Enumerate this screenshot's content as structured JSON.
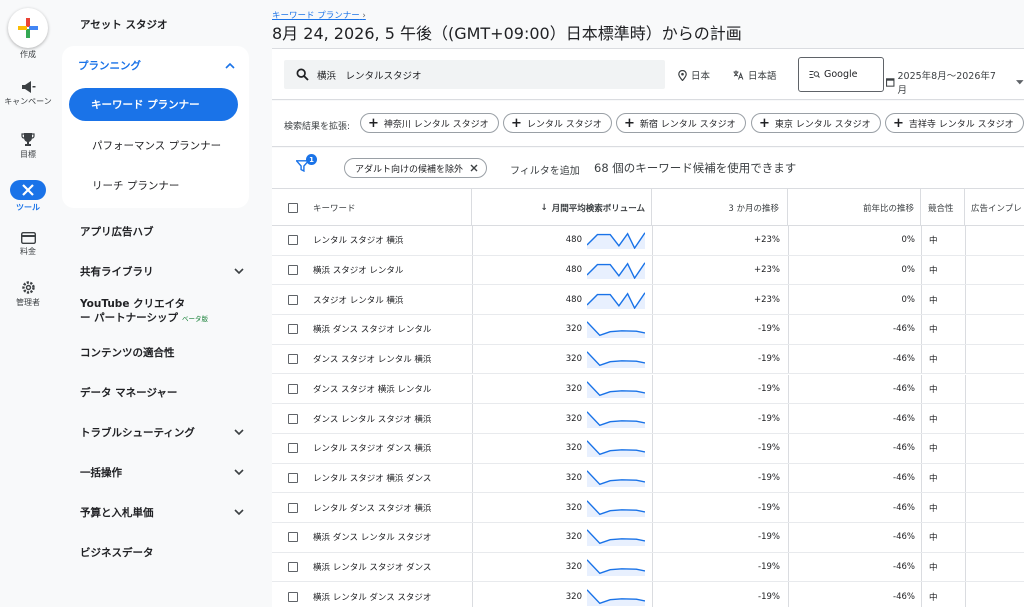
{
  "rail": {
    "create": "作成",
    "campaigns": "キャンペーン",
    "goals": "目標",
    "tools": "ツール",
    "billing": "料金",
    "admin": "管理者"
  },
  "nav": {
    "asset_studio": "アセット スタジオ",
    "planning": "プランニング",
    "keyword_planner": "キーワード プランナー",
    "performance_planner": "パフォーマンス プランナー",
    "reach_planner": "リーチ プランナー",
    "app_ad_hub": "アプリ広告ハブ",
    "shared_library": "共有ライブラリ",
    "youtube_partnership_line1": "YouTube クリエイタ",
    "youtube_partnership_line2": "ー パートナーシップ",
    "beta": "ベータ版",
    "content_suitability": "コンテンツの適合性",
    "data_manager": "データ マネージャー",
    "troubleshooting": "トラブルシューティング",
    "bulk_actions": "一括操作",
    "budgets_bids": "予算と入札単価",
    "business_data": "ビジネスデータ"
  },
  "header": {
    "breadcrumb": "キーワード プランナー",
    "title": "8月 24, 2026, 5 午後（(GMT+09:00）日本標準時）からの計画"
  },
  "toolbar": {
    "search_value": "横浜　レンタルスタジオ",
    "location": "日本",
    "language": "日本語",
    "network": "Google",
    "date_range": "2025年8月〜2026年7月"
  },
  "broaden": {
    "label": "検索結果を拡張:",
    "chips": [
      "神奈川 レンタル スタジオ",
      "レンタル スタジオ",
      "新宿 レンタル スタジオ",
      "東京 レンタル スタジオ",
      "吉祥寺 レンタル スタジオ"
    ]
  },
  "filters": {
    "badge": "1",
    "adult_chip": "アダルト向けの候補を除外",
    "add_filter": "フィルタを追加",
    "count_text": "68 個のキーワード候補を使用できます"
  },
  "table": {
    "headers": {
      "keyword": "キーワード",
      "volume": "月間平均検索ボリューム",
      "three_month": "3 か月の推移",
      "yoy": "前年比の推移",
      "competition": "競合性",
      "impression_share": "広告インプレ"
    },
    "rows": [
      {
        "keyword": "レンタル スタジオ 横浜",
        "volume": "480",
        "three_month": "+23%",
        "yoy": "0%",
        "competition": "中",
        "trend": "up"
      },
      {
        "keyword": "横浜 スタジオ レンタル",
        "volume": "480",
        "three_month": "+23%",
        "yoy": "0%",
        "competition": "中",
        "trend": "up"
      },
      {
        "keyword": "スタジオ レンタル 横浜",
        "volume": "480",
        "three_month": "+23%",
        "yoy": "0%",
        "competition": "中",
        "trend": "up"
      },
      {
        "keyword": "横浜 ダンス スタジオ レンタル",
        "volume": "320",
        "three_month": "-19%",
        "yoy": "-46%",
        "competition": "中",
        "trend": "down"
      },
      {
        "keyword": "ダンス スタジオ レンタル 横浜",
        "volume": "320",
        "three_month": "-19%",
        "yoy": "-46%",
        "competition": "中",
        "trend": "down"
      },
      {
        "keyword": "ダンス スタジオ 横浜 レンタル",
        "volume": "320",
        "three_month": "-19%",
        "yoy": "-46%",
        "competition": "中",
        "trend": "down"
      },
      {
        "keyword": "ダンス レンタル スタジオ 横浜",
        "volume": "320",
        "three_month": "-19%",
        "yoy": "-46%",
        "competition": "中",
        "trend": "down"
      },
      {
        "keyword": "レンタル スタジオ ダンス 横浜",
        "volume": "320",
        "three_month": "-19%",
        "yoy": "-46%",
        "competition": "中",
        "trend": "down"
      },
      {
        "keyword": "レンタル スタジオ 横浜 ダンス",
        "volume": "320",
        "three_month": "-19%",
        "yoy": "-46%",
        "competition": "中",
        "trend": "down"
      },
      {
        "keyword": "レンタル ダンス スタジオ 横浜",
        "volume": "320",
        "three_month": "-19%",
        "yoy": "-46%",
        "competition": "中",
        "trend": "down"
      },
      {
        "keyword": "横浜 ダンス レンタル スタジオ",
        "volume": "320",
        "three_month": "-19%",
        "yoy": "-46%",
        "competition": "中",
        "trend": "down"
      },
      {
        "keyword": "横浜 レンタル スタジオ ダンス",
        "volume": "320",
        "three_month": "-19%",
        "yoy": "-46%",
        "competition": "中",
        "trend": "down"
      },
      {
        "keyword": "横浜 レンタル ダンス スタジオ",
        "volume": "320",
        "three_month": "-19%",
        "yoy": "-46%",
        "competition": "中",
        "trend": "down"
      }
    ]
  },
  "colors": {
    "accent": "#1a73e8",
    "google_red": "#ea4335",
    "google_yellow": "#fbbc04",
    "google_green": "#34a853"
  }
}
